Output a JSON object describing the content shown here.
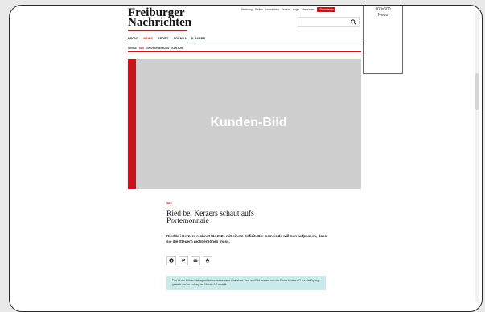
{
  "header": {
    "logo_line1": "Freiburger",
    "logo_line2": "Nachrichten",
    "util_links": [
      "Werbung",
      "Stellen",
      "Immobilien",
      "Service",
      "Login",
      "Newsletter"
    ],
    "subscribe_label": "Abonnieren",
    "search_placeholder": ""
  },
  "main_nav": [
    "FRONT",
    "NEWS",
    "SPORT",
    "AGENDA",
    "E-PAPER"
  ],
  "main_nav_active": "NEWS",
  "sub_nav": [
    "SENSE",
    "SEE",
    "GROSSFREIBURG",
    "KANTON"
  ],
  "sub_nav_active": "SEE",
  "ad": {
    "size": "300x600",
    "label": "News"
  },
  "hero": {
    "text": "Kunden-Bild"
  },
  "article": {
    "kicker": "SEE",
    "headline": "Ried bei Kerzers schaut aufs Portemonnaie",
    "lead": "Ried bei Kerzers rechnet für 2021 mit einem Defizit. Die Gemeinde will nun aufpassen, dass sie die Steuern nicht erhöhen muss.",
    "share_icons": [
      "facebook-icon",
      "twitter-icon",
      "email-icon",
      "print-icon"
    ],
    "notice": "Das ist ein fiktiver Beitrag mit kennzeichnendem Charakter. Text und Bild wurden von der Firma Muster AG zur Verfügung gestellt und im Auftrag der Muster AG erstellt."
  },
  "colors": {
    "accent": "#c8151b",
    "hero_bg": "#cfcfcf",
    "notice_bg": "#c9ecea"
  }
}
